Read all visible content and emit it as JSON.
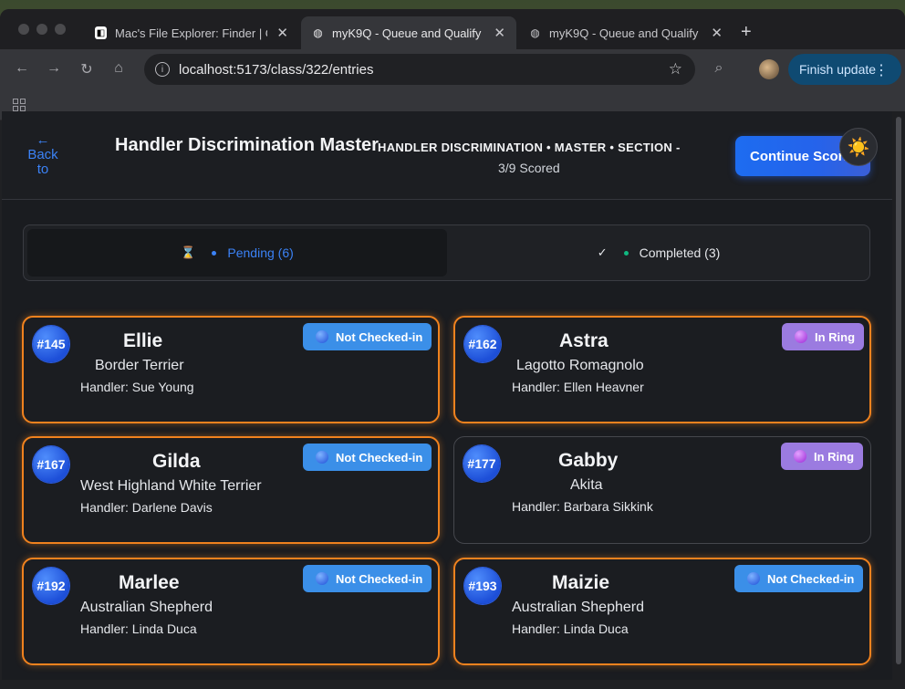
{
  "browser": {
    "tabs": [
      {
        "title": "Mac's File Explorer: Finder | G",
        "favicon": "app-icon"
      },
      {
        "title": "myK9Q - Queue and Qualify",
        "favicon": "globe-icon"
      },
      {
        "title": "myK9Q - Queue and Qualify",
        "favicon": "globe-icon"
      }
    ],
    "url": "localhost:5173/class/322/entries",
    "finish_update": "Finish update"
  },
  "header": {
    "back_label": "← Back to Classes",
    "class_title": "Handler Discrimination Master",
    "class_subtitle": "HANDLER DISCRIMINATION • MASTER • SECTION -",
    "scored": "3/9 Scored",
    "continue_label": "Continue Scoring",
    "theme_icon": "☀️"
  },
  "tabs": {
    "pending": {
      "icon": "⌛",
      "label": "Pending (6)",
      "color": "#3b82f6"
    },
    "completed": {
      "icon": "✓",
      "label": "Completed (3)",
      "color": "#10b981"
    }
  },
  "entries": [
    {
      "armband": "#145",
      "name": "Ellie",
      "breed": "Border Terrier",
      "handler": "Handler: Sue Young",
      "status": "Not Checked-in"
    },
    {
      "armband": "#162",
      "name": "Astra",
      "breed": "Lagotto Romagnolo",
      "handler": "Handler: Ellen Heavner",
      "status": "In Ring"
    },
    {
      "armband": "#167",
      "name": "Gilda",
      "breed": "West Highland White Terrier",
      "handler": "Handler: Darlene Davis",
      "status": "Not Checked-in"
    },
    {
      "armband": "#177",
      "name": "Gabby",
      "breed": "Akita",
      "handler": "Handler: Barbara Sikkink",
      "status": "In Ring"
    },
    {
      "armband": "#192",
      "name": "Marlee",
      "breed": "Australian Shepherd",
      "handler": "Handler: Linda Duca",
      "status": "Not Checked-in"
    },
    {
      "armband": "#193",
      "name": "Maizie",
      "breed": "Australian Shepherd",
      "handler": "Handler: Linda Duca",
      "status": "Not Checked-in"
    }
  ],
  "colors": {
    "accent_orange": "#f0821e",
    "primary_blue": "#2563eb",
    "badge_blue": "#3b8fe8",
    "badge_purple": "#9b7be0"
  }
}
